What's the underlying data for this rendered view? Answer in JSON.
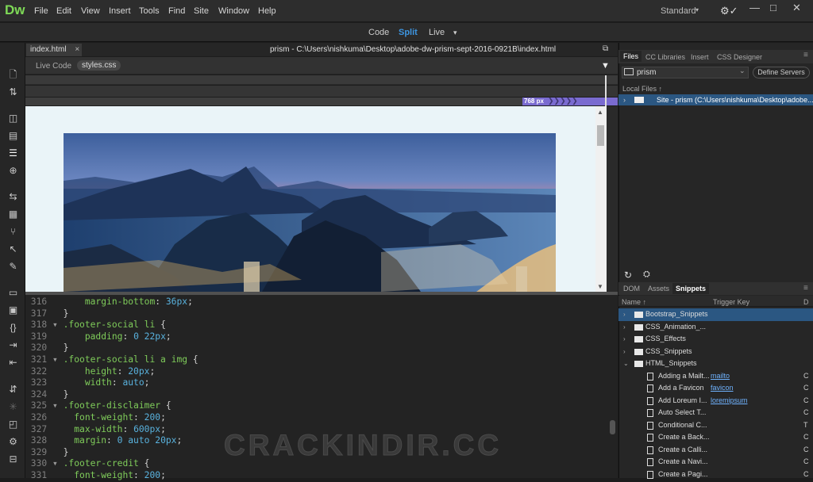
{
  "app": {
    "logo": "Dw",
    "menu": [
      "File",
      "Edit",
      "View",
      "Insert",
      "Tools",
      "Find",
      "Site",
      "Window",
      "Help"
    ],
    "workspace": "Standard",
    "window_controls": [
      "—",
      "□",
      "✕"
    ]
  },
  "viewbar": {
    "code": "Code",
    "split": "Split",
    "live": "Live",
    "live_arrow": "▾",
    "active": "Split"
  },
  "document": {
    "tab": "index.html",
    "tab_close": "×",
    "path": "prism - C:\\Users\\nishkuma\\Desktop\\adobe-dw-prism-sept-2016-0921B\\index.html",
    "related": [
      "Live Code",
      "styles.css"
    ],
    "media_width": "768 px"
  },
  "code": [
    {
      "n": "316",
      "fold": "",
      "t": [
        [
          "prop",
          "    margin-bottom"
        ],
        [
          "pun",
          ": "
        ],
        [
          "val",
          "36px"
        ],
        [
          "pun",
          ";"
        ]
      ]
    },
    {
      "n": "317",
      "fold": "",
      "t": [
        [
          "pun",
          "}"
        ]
      ]
    },
    {
      "n": "318",
      "fold": "▾",
      "t": [
        [
          "sel",
          ".footer-social li "
        ],
        [
          "pun",
          "{"
        ]
      ]
    },
    {
      "n": "319",
      "fold": "",
      "t": [
        [
          "prop",
          "    padding"
        ],
        [
          "pun",
          ": "
        ],
        [
          "val",
          "0 22px"
        ],
        [
          "pun",
          ";"
        ]
      ]
    },
    {
      "n": "320",
      "fold": "",
      "t": [
        [
          "pun",
          "}"
        ]
      ]
    },
    {
      "n": "321",
      "fold": "▾",
      "t": [
        [
          "sel",
          ".footer-social li a img "
        ],
        [
          "pun",
          "{"
        ]
      ]
    },
    {
      "n": "322",
      "fold": "",
      "t": [
        [
          "prop",
          "    height"
        ],
        [
          "pun",
          ": "
        ],
        [
          "val",
          "20px"
        ],
        [
          "pun",
          ";"
        ]
      ]
    },
    {
      "n": "323",
      "fold": "",
      "t": [
        [
          "prop",
          "    width"
        ],
        [
          "pun",
          ": "
        ],
        [
          "val",
          "auto"
        ],
        [
          "pun",
          ";"
        ]
      ]
    },
    {
      "n": "324",
      "fold": "",
      "t": [
        [
          "pun",
          "}"
        ]
      ]
    },
    {
      "n": "325",
      "fold": "▾",
      "t": [
        [
          "sel",
          ".footer-disclaimer "
        ],
        [
          "pun",
          "{"
        ]
      ]
    },
    {
      "n": "326",
      "fold": "",
      "t": [
        [
          "prop",
          "  font-weight"
        ],
        [
          "pun",
          ": "
        ],
        [
          "val",
          "200"
        ],
        [
          "pun",
          ";"
        ]
      ]
    },
    {
      "n": "327",
      "fold": "",
      "t": [
        [
          "prop",
          "  max-width"
        ],
        [
          "pun",
          ": "
        ],
        [
          "val",
          "600px"
        ],
        [
          "pun",
          ";"
        ]
      ]
    },
    {
      "n": "328",
      "fold": "",
      "t": [
        [
          "prop",
          "  margin"
        ],
        [
          "pun",
          ": "
        ],
        [
          "val",
          "0 auto 20px"
        ],
        [
          "pun",
          ";"
        ]
      ]
    },
    {
      "n": "329",
      "fold": "",
      "t": [
        [
          "pun",
          "}"
        ]
      ]
    },
    {
      "n": "330",
      "fold": "▾",
      "t": [
        [
          "sel",
          ".footer-credit "
        ],
        [
          "pun",
          "{"
        ]
      ]
    },
    {
      "n": "331",
      "fold": "",
      "t": [
        [
          "prop",
          "  font-weight"
        ],
        [
          "pun",
          ": "
        ],
        [
          "val",
          "200"
        ],
        [
          "pun",
          ";"
        ]
      ]
    }
  ],
  "files_panel": {
    "tabs": [
      "Files",
      "CC Libraries",
      "Insert",
      "CSS Designer"
    ],
    "site": "prism",
    "define_servers": "Define Servers",
    "local_files": "Local Files ↑",
    "site_row": "Site - prism (C:\\Users\\nishkuma\\Desktop\\adobe..."
  },
  "snippets_panel": {
    "tabs": [
      "DOM",
      "Assets",
      "Snippets"
    ],
    "headers": {
      "name": "Name ↑",
      "trigger": "Trigger Key",
      "d": "D"
    },
    "rows": [
      {
        "level": 0,
        "type": "folder",
        "label": "Bootstrap_Snippets",
        "trigger": "",
        "d": "",
        "expanded": false,
        "selected": true
      },
      {
        "level": 0,
        "type": "folder",
        "label": "CSS_Animation_...",
        "trigger": "",
        "d": "",
        "expanded": false,
        "selected": false
      },
      {
        "level": 0,
        "type": "folder",
        "label": "CSS_Effects",
        "trigger": "",
        "d": "",
        "expanded": false,
        "selected": false
      },
      {
        "level": 0,
        "type": "folder",
        "label": "CSS_Snippets",
        "trigger": "",
        "d": "",
        "expanded": false,
        "selected": false
      },
      {
        "level": 0,
        "type": "folder",
        "label": "HTML_Snippets",
        "trigger": "",
        "d": "",
        "expanded": true,
        "selected": false
      },
      {
        "level": 1,
        "type": "file",
        "label": "Adding a Mailt...",
        "trigger": "mailto",
        "d": "C",
        "selected": false
      },
      {
        "level": 1,
        "type": "file",
        "label": "Add a Favicon",
        "trigger": "favicon",
        "d": "C",
        "selected": false
      },
      {
        "level": 1,
        "type": "file",
        "label": "Add Loreum I...",
        "trigger": "loremipsum",
        "d": "C",
        "selected": false
      },
      {
        "level": 1,
        "type": "file",
        "label": "Auto Select T...",
        "trigger": "",
        "d": "C",
        "selected": false
      },
      {
        "level": 1,
        "type": "file",
        "label": "Conditional C...",
        "trigger": "",
        "d": "T",
        "selected": false
      },
      {
        "level": 1,
        "type": "file",
        "label": "Create a Back...",
        "trigger": "",
        "d": "C",
        "selected": false
      },
      {
        "level": 1,
        "type": "file",
        "label": "Create a Calli...",
        "trigger": "",
        "d": "C",
        "selected": false
      },
      {
        "level": 1,
        "type": "file",
        "label": "Create a Navi...",
        "trigger": "",
        "d": "C",
        "selected": false
      },
      {
        "level": 1,
        "type": "file",
        "label": "Create a Pagi...",
        "trigger": "",
        "d": "C",
        "selected": false
      }
    ]
  },
  "watermark": "CRACKINDIR.CC"
}
